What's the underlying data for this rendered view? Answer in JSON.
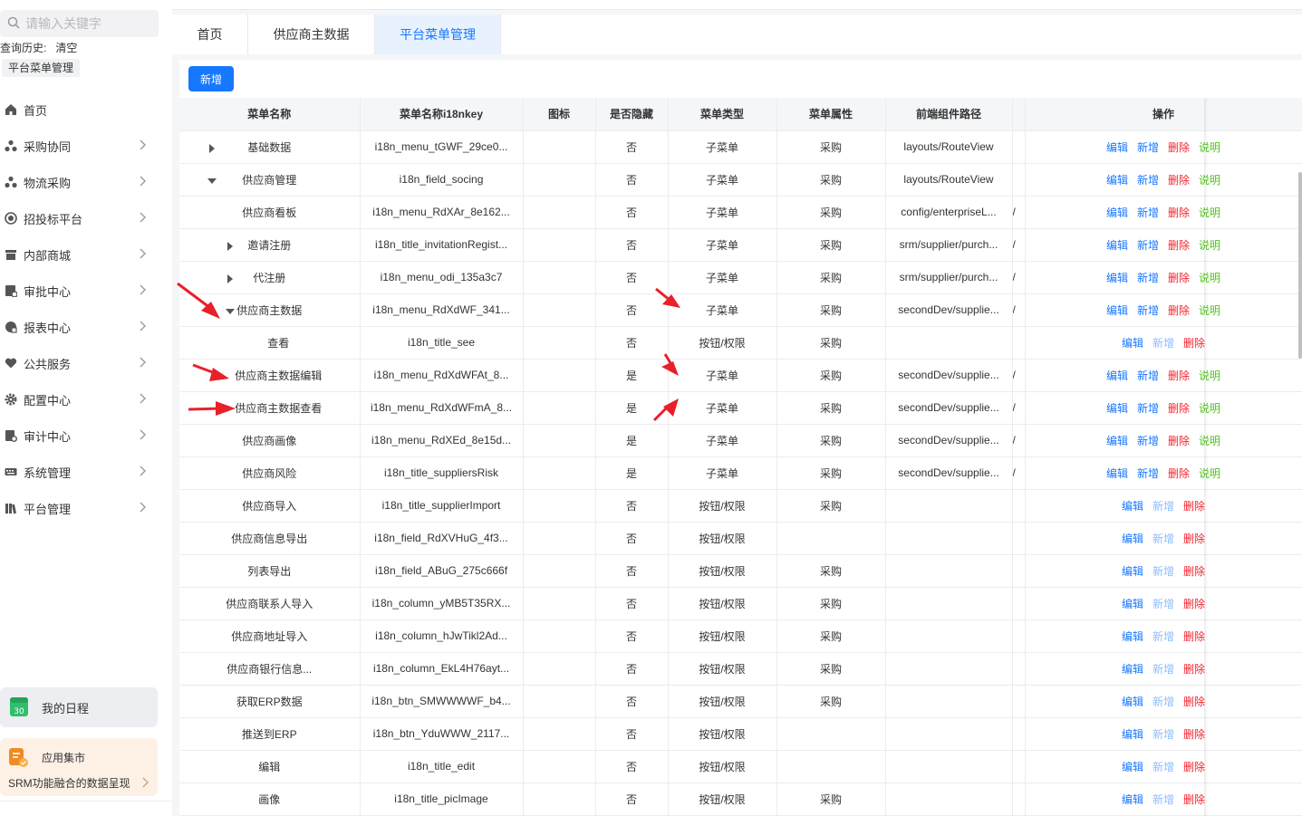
{
  "sidebar": {
    "search_placeholder": "请输入关键字",
    "history_label": "查询历史:",
    "history_clear": "清空",
    "history_tag": "平台菜单管理",
    "items": [
      {
        "label": "首页",
        "icon": "home-icon"
      },
      {
        "label": "采购协同",
        "icon": "cluster-icon"
      },
      {
        "label": "物流采购",
        "icon": "cluster-icon"
      },
      {
        "label": "招投标平台",
        "icon": "target-icon"
      },
      {
        "label": "内部商城",
        "icon": "shop-icon"
      },
      {
        "label": "审批中心",
        "icon": "approval-icon"
      },
      {
        "label": "报表中心",
        "icon": "report-icon"
      },
      {
        "label": "公共服务",
        "icon": "heart-icon"
      },
      {
        "label": "配置中心",
        "icon": "gear-icon"
      },
      {
        "label": "审计中心",
        "icon": "audit-icon"
      },
      {
        "label": "系统管理",
        "icon": "keyboard-icon"
      },
      {
        "label": "平台管理",
        "icon": "books-icon"
      }
    ],
    "schedule_label": "我的日程",
    "schedule_icon_text": "30",
    "market_title": "应用集市",
    "market_desc": "SRM功能融合的数据呈现"
  },
  "tabs": [
    {
      "label": "首页",
      "active": false
    },
    {
      "label": "供应商主数据",
      "active": false
    },
    {
      "label": "平台菜单管理",
      "active": true
    }
  ],
  "toolbar": {
    "add_label": "新增"
  },
  "table": {
    "columns": [
      "菜单名称",
      "菜单名称i18nkey",
      "图标",
      "是否隐藏",
      "菜单类型",
      "菜单属性",
      "前端组件路径",
      "",
      "操作"
    ],
    "op_labels": {
      "edit": "编辑",
      "add": "新增",
      "delete": "删除",
      "desc": "说明"
    },
    "rows": [
      {
        "name": "基础数据",
        "key": "i18n_menu_tGWF_29ce0...",
        "hidden": "否",
        "type": "子菜单",
        "attr": "采购",
        "path": "layouts/RouteView",
        "slash": "",
        "expand": "right",
        "indent": 0,
        "full_ops": true
      },
      {
        "name": "供应商管理",
        "key": "i18n_field_socing",
        "hidden": "否",
        "type": "子菜单",
        "attr": "采购",
        "path": "layouts/RouteView",
        "slash": "",
        "expand": "down",
        "indent": 0,
        "full_ops": true
      },
      {
        "name": "供应商看板",
        "key": "i18n_menu_RdXAr_8e162...",
        "hidden": "否",
        "type": "子菜单",
        "attr": "采购",
        "path": "config/enterpriseL...",
        "slash": "/",
        "expand": "",
        "indent": 1,
        "full_ops": true
      },
      {
        "name": "邀请注册",
        "key": "i18n_title_invitationRegist...",
        "hidden": "否",
        "type": "子菜单",
        "attr": "采购",
        "path": "srm/supplier/purch...",
        "slash": "/",
        "expand": "right",
        "indent": 1,
        "full_ops": true
      },
      {
        "name": "代注册",
        "key": "i18n_menu_odi_135a3c7",
        "hidden": "否",
        "type": "子菜单",
        "attr": "采购",
        "path": "srm/supplier/purch...",
        "slash": "/",
        "expand": "right",
        "indent": 1,
        "full_ops": true
      },
      {
        "name": "供应商主数据",
        "key": "i18n_menu_RdXdWF_341...",
        "hidden": "否",
        "type": "子菜单",
        "attr": "采购",
        "path": "secondDev/supplie...",
        "slash": "/",
        "expand": "down",
        "indent": 1,
        "full_ops": true
      },
      {
        "name": "查看",
        "key": "i18n_title_see",
        "hidden": "否",
        "type": "按钮/权限",
        "attr": "采购",
        "path": "",
        "slash": "",
        "expand": "",
        "indent": 2,
        "full_ops": false
      },
      {
        "name": "供应商主数据编辑",
        "key": "i18n_menu_RdXdWFAt_8...",
        "hidden": "是",
        "type": "子菜单",
        "attr": "采购",
        "path": "secondDev/supplie...",
        "slash": "/",
        "expand": "",
        "indent": 2,
        "full_ops": true
      },
      {
        "name": "供应商主数据查看",
        "key": "i18n_menu_RdXdWFmA_8...",
        "hidden": "是",
        "type": "子菜单",
        "attr": "采购",
        "path": "secondDev/supplie...",
        "slash": "/",
        "expand": "",
        "indent": 2,
        "full_ops": true
      },
      {
        "name": "供应商画像",
        "key": "i18n_menu_RdXEd_8e15d...",
        "hidden": "是",
        "type": "子菜单",
        "attr": "采购",
        "path": "secondDev/supplie...",
        "slash": "/",
        "expand": "",
        "indent": 1,
        "full_ops": true
      },
      {
        "name": "供应商风险",
        "key": "i18n_title_suppliersRisk",
        "hidden": "是",
        "type": "子菜单",
        "attr": "采购",
        "path": "secondDev/supplie...",
        "slash": "/",
        "expand": "",
        "indent": 1,
        "full_ops": true
      },
      {
        "name": "供应商导入",
        "key": "i18n_title_supplierImport",
        "hidden": "否",
        "type": "按钮/权限",
        "attr": "采购",
        "path": "",
        "slash": "",
        "expand": "",
        "indent": 1,
        "full_ops": false
      },
      {
        "name": "供应商信息导出",
        "key": "i18n_field_RdXVHuG_4f3...",
        "hidden": "否",
        "type": "按钮/权限",
        "attr": "",
        "path": "",
        "slash": "",
        "expand": "",
        "indent": 1,
        "full_ops": false
      },
      {
        "name": "列表导出",
        "key": "i18n_field_ABuG_275c666f",
        "hidden": "否",
        "type": "按钮/权限",
        "attr": "采购",
        "path": "",
        "slash": "",
        "expand": "",
        "indent": 1,
        "full_ops": false
      },
      {
        "name": "供应商联系人导入",
        "key": "i18n_column_yMB5T35RX...",
        "hidden": "否",
        "type": "按钮/权限",
        "attr": "采购",
        "path": "",
        "slash": "",
        "expand": "",
        "indent": 1,
        "full_ops": false
      },
      {
        "name": "供应商地址导入",
        "key": "i18n_column_hJwTikl2Ad...",
        "hidden": "否",
        "type": "按钮/权限",
        "attr": "采购",
        "path": "",
        "slash": "",
        "expand": "",
        "indent": 1,
        "full_ops": false
      },
      {
        "name": "供应商银行信息...",
        "key": "i18n_column_EkL4H76ayt...",
        "hidden": "否",
        "type": "按钮/权限",
        "attr": "采购",
        "path": "",
        "slash": "",
        "expand": "",
        "indent": 1,
        "full_ops": false
      },
      {
        "name": "获取ERP数据",
        "key": "i18n_btn_SMWWWWF_b4...",
        "hidden": "否",
        "type": "按钮/权限",
        "attr": "采购",
        "path": "",
        "slash": "",
        "expand": "",
        "indent": 1,
        "full_ops": false
      },
      {
        "name": "推送到ERP",
        "key": "i18n_btn_YduWWW_2117...",
        "hidden": "否",
        "type": "按钮/权限",
        "attr": "",
        "path": "",
        "slash": "",
        "expand": "",
        "indent": 1,
        "full_ops": false
      },
      {
        "name": "编辑",
        "key": "i18n_title_edit",
        "hidden": "否",
        "type": "按钮/权限",
        "attr": "",
        "path": "",
        "slash": "",
        "expand": "",
        "indent": 1,
        "full_ops": false
      },
      {
        "name": "画像",
        "key": "i18n_title_picImage",
        "hidden": "否",
        "type": "按钮/权限",
        "attr": "采购",
        "path": "",
        "slash": "",
        "expand": "",
        "indent": 1,
        "full_ops": false
      }
    ]
  },
  "colors": {
    "accent": "#1677ff",
    "danger": "#f5222d",
    "success": "#52c41a",
    "annotation_arrow": "#e8202a"
  }
}
